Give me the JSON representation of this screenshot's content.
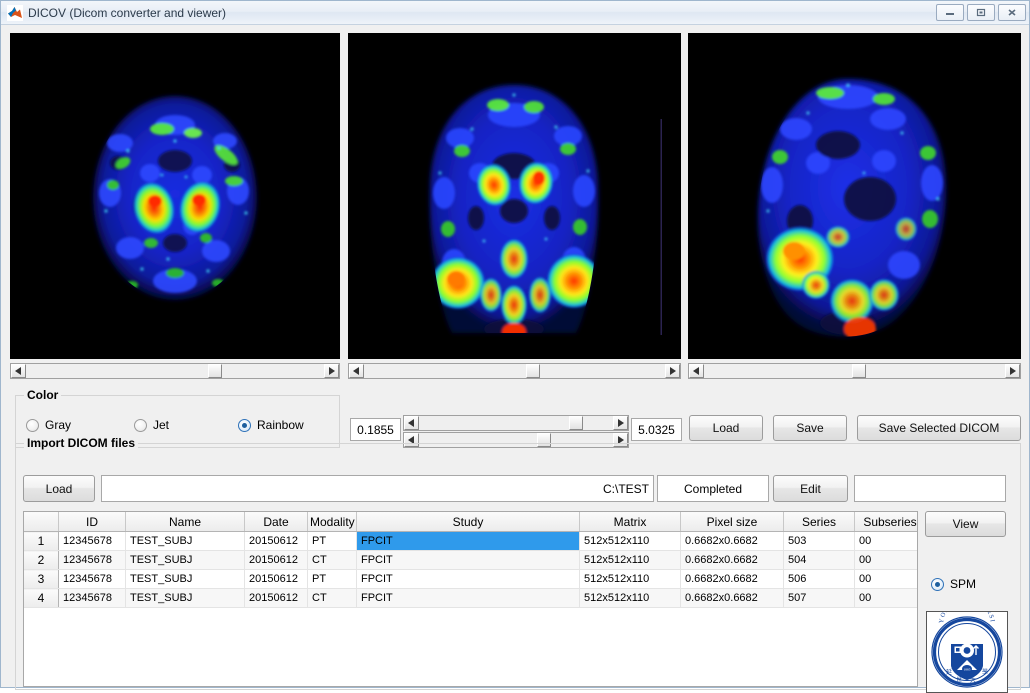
{
  "window": {
    "title": "DICOV (Dicom converter and viewer)",
    "icon": "matlab-icon",
    "controls": [
      {
        "name": "minimize-button",
        "glyph": "minimize-icon"
      },
      {
        "name": "restore-button",
        "glyph": "restore-icon"
      },
      {
        "name": "close-button",
        "glyph": "close-icon"
      }
    ]
  },
  "viewer": {
    "panels": [
      {
        "name": "axial-view",
        "orientation": "axial"
      },
      {
        "name": "coronal-view",
        "orientation": "coronal"
      },
      {
        "name": "sagittal-view",
        "orientation": "sagittal"
      }
    ]
  },
  "color_panel": {
    "title": "Color",
    "options": [
      {
        "label": "Gray",
        "selected": false
      },
      {
        "label": "Jet",
        "selected": false
      },
      {
        "label": "Rainbow",
        "selected": true
      }
    ]
  },
  "window_level": {
    "min_value": "0.1855",
    "max_value": "5.0325"
  },
  "toolbar": {
    "load_label": "Load",
    "save_label": "Save",
    "save_selected_label": "Save Selected DICOM"
  },
  "import_panel": {
    "title": "Import DICOM files",
    "load_label": "Load",
    "path_value": "C:\\TEST",
    "path_placeholder": "",
    "status_value": "Completed",
    "edit_label": "Edit",
    "extra_value": "",
    "extra_placeholder": ""
  },
  "table": {
    "columns": [
      "",
      "ID",
      "Name",
      "Date",
      "Modality",
      "Study",
      "Matrix",
      "Pixel size",
      "Series",
      "Subseries"
    ],
    "rows": [
      {
        "num": "1",
        "id": "12345678",
        "name": "TEST_SUBJ",
        "date": "20150612",
        "modality": "PT",
        "study": "FPCIT",
        "matrix": "512x512x110",
        "pixel": "0.6682x0.6682",
        "series": "503",
        "subseries": "00",
        "selected": true
      },
      {
        "num": "2",
        "id": "12345678",
        "name": "TEST_SUBJ",
        "date": "20150612",
        "modality": "CT",
        "study": "FPCIT",
        "matrix": "512x512x110",
        "pixel": "0.6682x0.6682",
        "series": "504",
        "subseries": "00",
        "selected": false
      },
      {
        "num": "3",
        "id": "12345678",
        "name": "TEST_SUBJ",
        "date": "20150612",
        "modality": "PT",
        "study": "FPCIT",
        "matrix": "512x512x110",
        "pixel": "0.6682x0.6682",
        "series": "506",
        "subseries": "00",
        "selected": false
      },
      {
        "num": "4",
        "id": "12345678",
        "name": "TEST_SUBJ",
        "date": "20150612",
        "modality": "CT",
        "study": "FPCIT",
        "matrix": "512x512x110",
        "pixel": "0.6682x0.6682",
        "series": "507",
        "subseries": "00",
        "selected": false
      }
    ]
  },
  "side_panel": {
    "view_label": "View",
    "spm_label": "SPM",
    "spm_selected": true,
    "logo_name": "yonsei-university-logo",
    "logo_text_top": "YONSEI UNIVERSITY"
  },
  "colors": {
    "selection_blue": "#2f9aeb",
    "window_bg": "#f0f0f0",
    "panel_black": "#000000",
    "logo_blue": "#15479e"
  }
}
